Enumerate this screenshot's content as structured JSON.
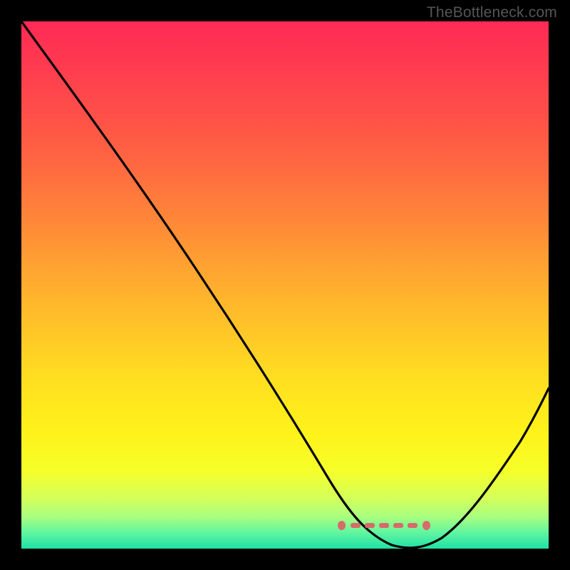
{
  "watermark": "TheBottleneck.com",
  "chart_data": {
    "type": "line",
    "title": "",
    "xlabel": "",
    "ylabel": "",
    "xlim": [
      0,
      100
    ],
    "ylim": [
      0,
      100
    ],
    "grid": false,
    "legend": false,
    "annotations": [],
    "series": [
      {
        "name": "curve",
        "x": [
          0,
          5,
          10,
          15,
          20,
          25,
          30,
          35,
          40,
          45,
          50,
          55,
          60,
          63,
          66,
          70,
          74,
          78,
          82,
          86,
          90,
          95,
          100
        ],
        "values": [
          100,
          93,
          86,
          79,
          72,
          65,
          57,
          49,
          41,
          33,
          25,
          17,
          10,
          6,
          3,
          1,
          0,
          1,
          4,
          10,
          17,
          26,
          35
        ]
      }
    ],
    "background_gradient": {
      "direction": "vertical",
      "stops": [
        {
          "pos": 0,
          "color": "#ff2a55"
        },
        {
          "pos": 50,
          "color": "#ffb030"
        },
        {
          "pos": 80,
          "color": "#fff21a"
        },
        {
          "pos": 100,
          "color": "#1ee1a5"
        }
      ]
    },
    "markers": {
      "name": "optimal-band",
      "x_start": 62,
      "x_end": 78,
      "y": 4,
      "color": "#d86a6a"
    }
  }
}
